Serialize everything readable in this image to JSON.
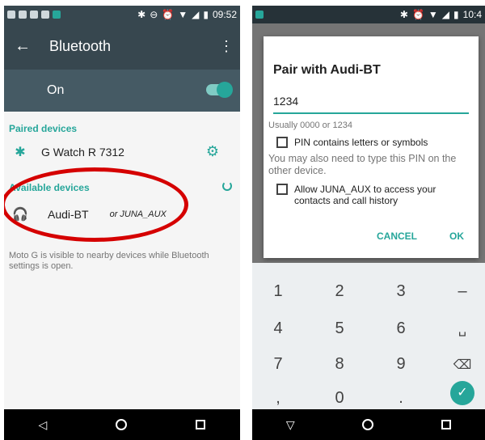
{
  "left": {
    "status_time": "09:52",
    "title": "Bluetooth",
    "onbar_label": "On",
    "paired_header": "Paired devices",
    "paired_device": "G Watch R 7312",
    "available_header": "Available devices",
    "available_device": "Audi-BT",
    "available_alt": "or JUNA_AUX",
    "info_text": "Moto G is visible to nearby devices while Bluetooth settings is open."
  },
  "right": {
    "status_time": "10:4",
    "dialog_title": "Pair with Audi-BT",
    "pin_value": "1234",
    "hint": "Usually 0000 or 1234",
    "pin_letters_label": "PIN contains letters or symbols",
    "note": "You may also need to type this PIN on the other device.",
    "allow_label": "Allow JUNA_AUX to access your contacts and call history",
    "cancel_label": "CANCEL",
    "ok_label": "OK",
    "keys": [
      "1",
      "2",
      "3",
      "–",
      "4",
      "5",
      "6",
      "␣",
      "7",
      "8",
      "9",
      "⌫",
      ",",
      "0",
      ".",
      "✓"
    ]
  },
  "icons": {
    "bluetooth": "bluetooth-icon",
    "headphones": "headphones-icon",
    "gear": "gear-icon",
    "back": "back-arrow-icon"
  },
  "colors": {
    "accent": "#26a69a",
    "appbar": "#37474f",
    "onbar": "#455a64",
    "annotation": "#d50000"
  }
}
